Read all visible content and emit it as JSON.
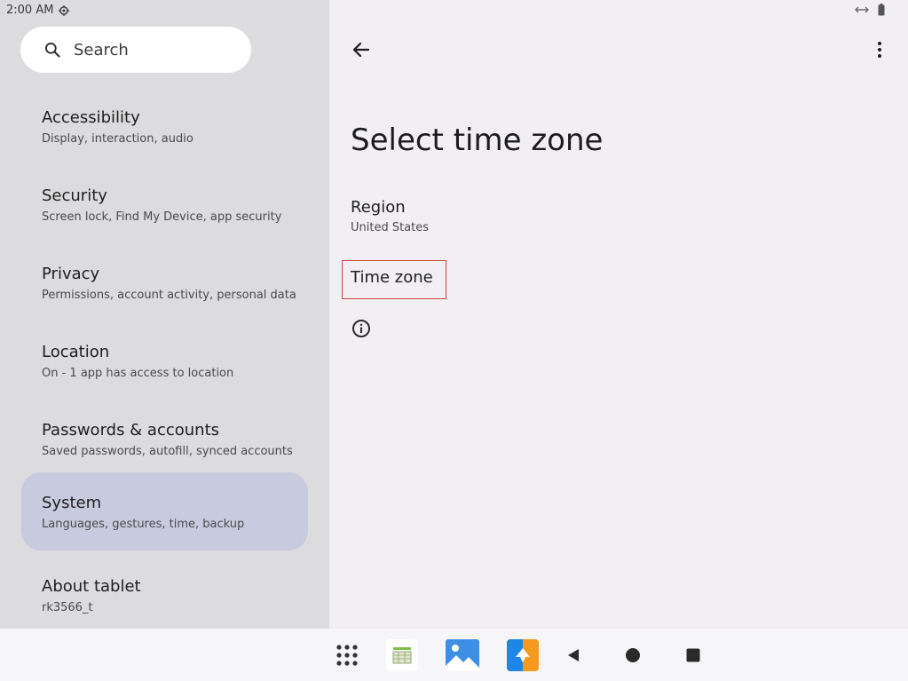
{
  "status": {
    "time": "2:00 AM"
  },
  "search": {
    "label": "Search"
  },
  "sidebar": {
    "items": [
      {
        "title": "Accessibility",
        "subtitle": "Display, interaction, audio"
      },
      {
        "title": "Security",
        "subtitle": "Screen lock, Find My Device, app security"
      },
      {
        "title": "Privacy",
        "subtitle": "Permissions, account activity, personal data"
      },
      {
        "title": "Location",
        "subtitle": "On - 1 app has access to location"
      },
      {
        "title": "Passwords & accounts",
        "subtitle": "Saved passwords, autofill, synced accounts"
      },
      {
        "title": "System",
        "subtitle": "Languages, gestures, time, backup",
        "selected": true
      },
      {
        "title": "About tablet",
        "subtitle": "rk3566_t"
      }
    ]
  },
  "main": {
    "title": "Select time zone",
    "region": {
      "title": "Region",
      "value": "United States"
    },
    "time_zone": {
      "title": "Time zone"
    }
  },
  "colors": {
    "selected_bg": "#c8cadf",
    "highlight_border": "#d04444"
  }
}
